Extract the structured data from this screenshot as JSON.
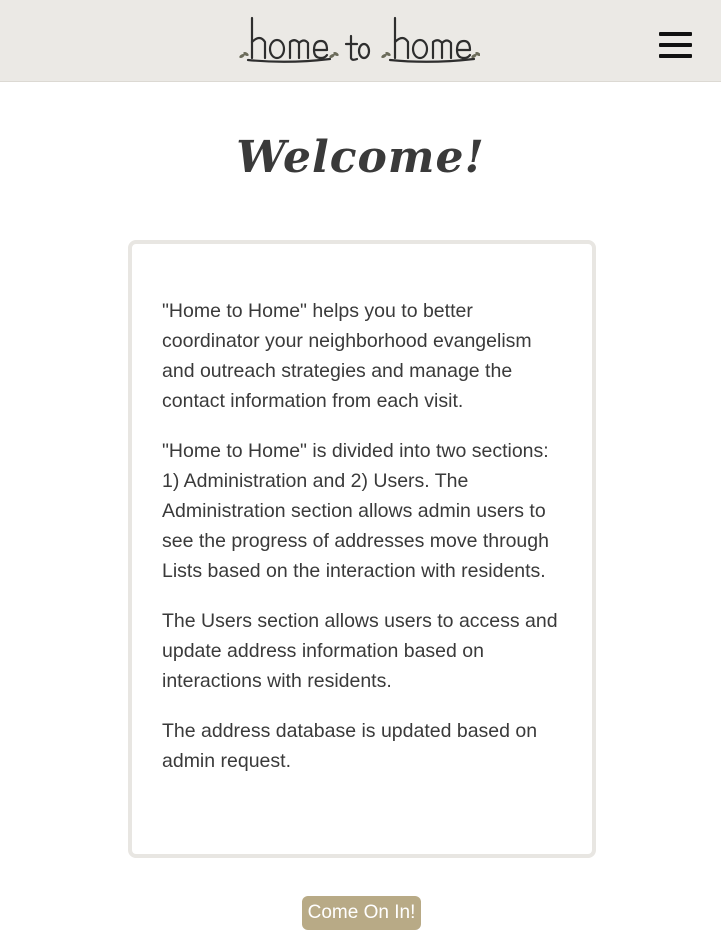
{
  "header": {
    "logo_text": "home to home",
    "menu_icon": "hamburger-menu-icon"
  },
  "main": {
    "title": "Welcome!",
    "paragraphs": [
      "\"Home to Home\" helps you to better coordinator your neighborhood evangelism and outreach strategies and manage the contact information from each visit.",
      "\"Home to Home\" is divided into two sections: 1) Administration and 2) Users. The Administration section allows admin users to see the progress of addresses move through Lists based on the interaction with residents.",
      "The Users section allows users to access and update address information based on interactions with residents.",
      "The address database is updated based on admin request."
    ],
    "cta_label": "Come On In!"
  },
  "colors": {
    "header_bg": "#ebe9e5",
    "text": "#3a3a3a",
    "card_border": "#e8e6e2",
    "button_bg": "#b8aa86",
    "button_text": "#ffffff"
  }
}
